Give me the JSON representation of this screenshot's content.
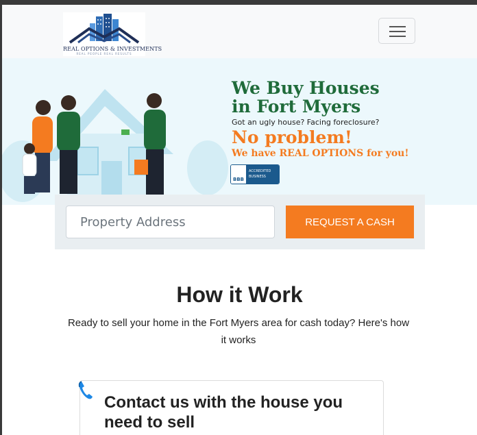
{
  "brand": {
    "name": "REAL OPTIONS & INVESTMENTS",
    "tagline": "REAL PEOPLE  REAL RESULTS"
  },
  "icons": {
    "logo": "house-buildings-logo-icon",
    "menu": "hamburger-menu-icon",
    "phone": "phone-icon",
    "bbb": "bbb-accredited-badge-icon"
  },
  "hero": {
    "title_line1": "We Buy Houses",
    "title_line2": "in Fort Myers",
    "subtitle": "Got an ugly house?  Facing foreclosure?",
    "no_problem": "No problem!",
    "options": "We have REAL OPTIONS for you!",
    "bbb_logo": "BBB",
    "bbb_line1": "ACCREDITED",
    "bbb_line2": "BUSINESS"
  },
  "search": {
    "placeholder": "Property Address",
    "button_label": "REQUEST A CASH OFFER"
  },
  "how": {
    "title": "How it Work",
    "description": "Ready to sell your home in the Fort Myers area for cash today? Here's how it works"
  },
  "steps": [
    {
      "title": "Contact us with the house you need to sell"
    }
  ],
  "colors": {
    "accent": "#f47b20",
    "green": "#1f6b3a",
    "navy": "#1f2f57",
    "hero_bg": "#ecf8fc"
  }
}
